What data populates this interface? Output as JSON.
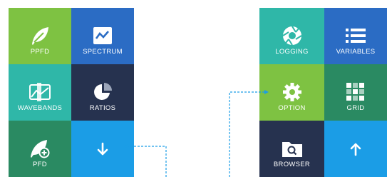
{
  "left_panel": {
    "tiles": [
      {
        "label": "PPFD",
        "icon": "leaf-icon",
        "color": "#7ec242"
      },
      {
        "label": "SPECTRUM",
        "icon": "spectrum-chart-icon",
        "color": "#2b6cc4"
      },
      {
        "label": "WAVEBANDS",
        "icon": "wavebands-icon",
        "color": "#2fb7a8"
      },
      {
        "label": "RATIOS",
        "icon": "pie-chart-icon",
        "color": "#26324f"
      },
      {
        "label": "PFD",
        "icon": "leaf-plus-icon",
        "color": "#2a8a62"
      },
      {
        "label": "",
        "icon": "arrow-down-icon",
        "color": "#1b9de6"
      }
    ]
  },
  "right_panel": {
    "tiles": [
      {
        "label": "LOGGING",
        "icon": "aperture-icon",
        "color": "#2fb7a8"
      },
      {
        "label": "VARIABLES",
        "icon": "list-icon",
        "color": "#2b6cc4"
      },
      {
        "label": "OPTION",
        "icon": "gear-icon",
        "color": "#7ec242"
      },
      {
        "label": "GRID",
        "icon": "grid-icon",
        "color": "#2a8a62"
      },
      {
        "label": "BROWSER",
        "icon": "folder-search-icon",
        "color": "#26324f"
      },
      {
        "label": "",
        "icon": "arrow-up-icon",
        "color": "#1b9de6"
      }
    ]
  },
  "connector_color": "#1b9de6"
}
